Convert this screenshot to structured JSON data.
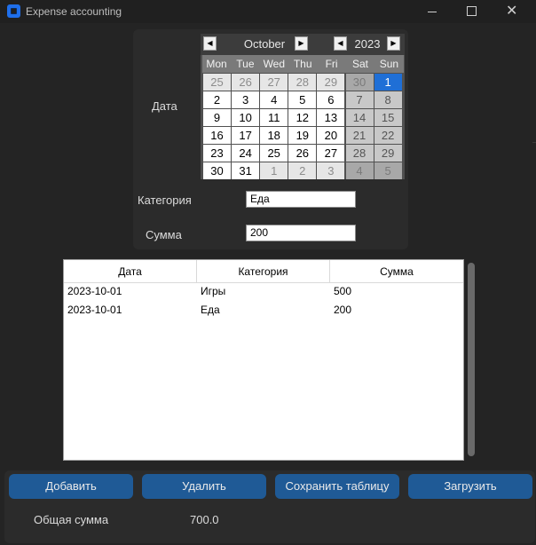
{
  "window": {
    "title": "Expense accounting",
    "icons": {
      "minimize": "minimize-icon",
      "maximize": "maximize-icon",
      "close": "close-icon"
    }
  },
  "form": {
    "date_label": "Дата",
    "category_label": "Категория",
    "sum_label": "Сумма",
    "category_value": "Еда",
    "sum_value": "200"
  },
  "calendar": {
    "month": "October",
    "year": "2023",
    "prev_symbol": "◀",
    "next_symbol": "▶",
    "day_names": [
      "Mon",
      "Tue",
      "Wed",
      "Thu",
      "Fri",
      "Sat",
      "Sun"
    ],
    "weeks": [
      [
        {
          "d": "25",
          "t": "other"
        },
        {
          "d": "26",
          "t": "other"
        },
        {
          "d": "27",
          "t": "other"
        },
        {
          "d": "28",
          "t": "other"
        },
        {
          "d": "29",
          "t": "other"
        },
        {
          "d": "30",
          "t": "we-other"
        },
        {
          "d": "1",
          "t": "sel"
        }
      ],
      [
        {
          "d": "2",
          "t": "norm"
        },
        {
          "d": "3",
          "t": "norm"
        },
        {
          "d": "4",
          "t": "norm"
        },
        {
          "d": "5",
          "t": "norm"
        },
        {
          "d": "6",
          "t": "norm"
        },
        {
          "d": "7",
          "t": "we"
        },
        {
          "d": "8",
          "t": "we"
        }
      ],
      [
        {
          "d": "9",
          "t": "norm"
        },
        {
          "d": "10",
          "t": "norm"
        },
        {
          "d": "11",
          "t": "norm"
        },
        {
          "d": "12",
          "t": "norm"
        },
        {
          "d": "13",
          "t": "norm"
        },
        {
          "d": "14",
          "t": "we"
        },
        {
          "d": "15",
          "t": "we"
        }
      ],
      [
        {
          "d": "16",
          "t": "norm"
        },
        {
          "d": "17",
          "t": "norm"
        },
        {
          "d": "18",
          "t": "norm"
        },
        {
          "d": "19",
          "t": "norm"
        },
        {
          "d": "20",
          "t": "norm"
        },
        {
          "d": "21",
          "t": "we"
        },
        {
          "d": "22",
          "t": "we"
        }
      ],
      [
        {
          "d": "23",
          "t": "norm"
        },
        {
          "d": "24",
          "t": "norm"
        },
        {
          "d": "25",
          "t": "norm"
        },
        {
          "d": "26",
          "t": "norm"
        },
        {
          "d": "27",
          "t": "norm"
        },
        {
          "d": "28",
          "t": "we"
        },
        {
          "d": "29",
          "t": "we"
        }
      ],
      [
        {
          "d": "30",
          "t": "norm"
        },
        {
          "d": "31",
          "t": "norm"
        },
        {
          "d": "1",
          "t": "other"
        },
        {
          "d": "2",
          "t": "other"
        },
        {
          "d": "3",
          "t": "other"
        },
        {
          "d": "4",
          "t": "we-other"
        },
        {
          "d": "5",
          "t": "we-other"
        }
      ]
    ]
  },
  "table": {
    "columns": [
      "Дата",
      "Категория",
      "Сумма"
    ],
    "rows": [
      [
        "2023-10-01",
        "Игры",
        "500"
      ],
      [
        "2023-10-01",
        "Еда",
        "200"
      ]
    ]
  },
  "buttons": {
    "add": "Добавить",
    "delete": "Удалить",
    "save": "Сохранить таблицу",
    "load": "Загрузить"
  },
  "total": {
    "label": "Общая сумма",
    "value": "700.0"
  },
  "colors": {
    "accent": "#1f5a96",
    "selected_day": "#1f6fd6",
    "background": "#242424"
  }
}
